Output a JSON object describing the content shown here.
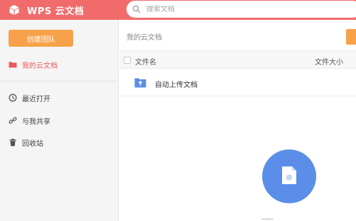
{
  "app": {
    "title": "WPS 云文档",
    "accent_color": "#f26b6b"
  },
  "search": {
    "placeholder": "搜索文档",
    "icon": "search-icon"
  },
  "sidebar": {
    "create_button": "创建团队",
    "items": [
      {
        "label": "我的云文档",
        "icon": "folder-icon",
        "active": true
      },
      {
        "label": "最近打开",
        "icon": "clock-icon",
        "active": false
      },
      {
        "label": "与我共享",
        "icon": "link-icon",
        "active": false
      },
      {
        "label": "回收站",
        "icon": "trash-icon",
        "active": false
      }
    ]
  },
  "main": {
    "breadcrumb": "我的云文档",
    "columns": {
      "name": "文件名",
      "size": "文件大小"
    },
    "files": [
      {
        "name": "自动上传文档",
        "icon": "upload-folder-icon",
        "size": ""
      }
    ],
    "empty_state": {
      "icon": "document-icon",
      "color": "#5b8ee8",
      "text": "ꟷꟷ"
    }
  }
}
